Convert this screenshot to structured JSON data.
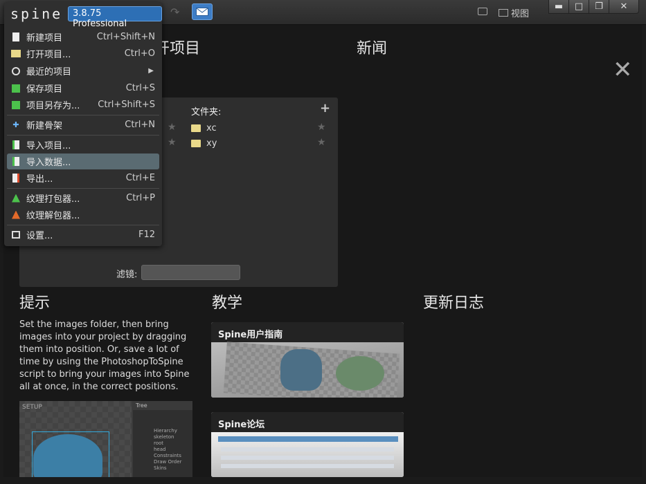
{
  "app": {
    "logo": "spine",
    "version": "3.8.75 Professional"
  },
  "toolbar": {
    "view_label": "视图"
  },
  "window_controls": {
    "minimize": "▬",
    "maximize": "□",
    "restore": "❐",
    "close": "✕"
  },
  "menu": {
    "items": [
      {
        "label": "新建项目",
        "shortcut": "Ctrl+Shift+N",
        "icon": "new-project-icon"
      },
      {
        "label": "打开项目...",
        "shortcut": "Ctrl+O",
        "icon": "folder-open-icon"
      },
      {
        "label": "最近的项目",
        "shortcut": "",
        "icon": "recent-icon"
      },
      {
        "label": "保存项目",
        "shortcut": "Ctrl+S",
        "icon": "save-icon"
      },
      {
        "label": "项目另存为...",
        "shortcut": "Ctrl+Shift+S",
        "icon": "save-as-icon"
      },
      {
        "label": "新建骨架",
        "shortcut": "Ctrl+N",
        "icon": "new-skeleton-icon"
      },
      {
        "label": "导入项目...",
        "shortcut": "",
        "icon": "import-project-icon"
      },
      {
        "label": "导入数据...",
        "shortcut": "",
        "icon": "import-data-icon"
      },
      {
        "label": "导出...",
        "shortcut": "Ctrl+E",
        "icon": "export-icon"
      },
      {
        "label": "纹理打包器...",
        "shortcut": "Ctrl+P",
        "icon": "texture-packer-icon"
      },
      {
        "label": "纹理解包器...",
        "shortcut": "",
        "icon": "texture-unpacker-icon"
      },
      {
        "label": "设置...",
        "shortcut": "F12",
        "icon": "settings-icon"
      }
    ]
  },
  "main": {
    "projects_heading_visible": "开项目",
    "news_heading": "新闻",
    "folders_label": "文件夹:",
    "folders": [
      "xc",
      "xy"
    ],
    "filter_label": "滤镜:",
    "tips_heading": "提示",
    "tips_text": "Set the images folder, then bring images into your project by dragging them into position. Or, save a lot of time by using the PhotoshopToSpine script to bring your images into Spine all at once, in the correct positions.",
    "tutorials_heading": "教学",
    "changelog_heading": "更新日志",
    "cards": {
      "guide": "Spine用户指南",
      "forum": "Spine论坛"
    },
    "setup_thumb": {
      "badge": "SETUP",
      "tree_title": "Tree",
      "tree_lines": [
        "Hierarchy",
        "skeleton",
        "root",
        "head",
        "Constraints",
        "Draw Order",
        "Skins"
      ]
    }
  }
}
